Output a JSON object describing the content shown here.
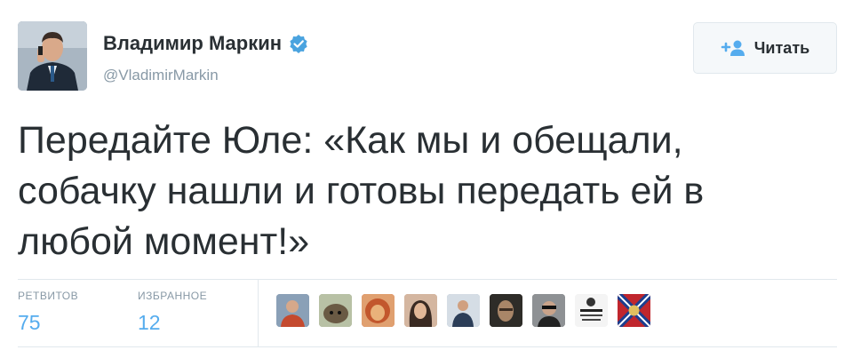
{
  "user": {
    "name": "Владимир Маркин",
    "handle": "@VladimirMarkin"
  },
  "follow_button": {
    "label": "Читать"
  },
  "tweet": {
    "lines": [
      "Передайте Юле: «Как мы и обещали,",
      "собачку нашли и готовы передать ей в",
      "любой момент!»"
    ]
  },
  "stats": {
    "retweets": {
      "label": "РЕТВИТОВ",
      "value": "75"
    },
    "favorites": {
      "label": "ИЗБРАННОЕ",
      "value": "12"
    }
  },
  "favoriters": [
    {
      "icon": "user-avatar-1",
      "bg": "#6f7f94"
    },
    {
      "icon": "user-avatar-hedgehog",
      "bg": "#8f9a7a"
    },
    {
      "icon": "user-avatar-lion",
      "bg": "#d8553a"
    },
    {
      "icon": "user-avatar-woman",
      "bg": "#c89a7d"
    },
    {
      "icon": "user-avatar-man",
      "bg": "#8ea2b8"
    },
    {
      "icon": "user-avatar-dark",
      "bg": "#3c3a36"
    },
    {
      "icon": "user-avatar-sunglasses",
      "bg": "#6b6d70"
    },
    {
      "icon": "user-avatar-text-logo",
      "bg": "#f2f2f2"
    },
    {
      "icon": "user-avatar-flag",
      "bg": "#c0262d"
    }
  ],
  "colors": {
    "accent": "#55acee",
    "verified": "#4aa3df",
    "text": "#292f33",
    "muted": "#8899a6"
  }
}
